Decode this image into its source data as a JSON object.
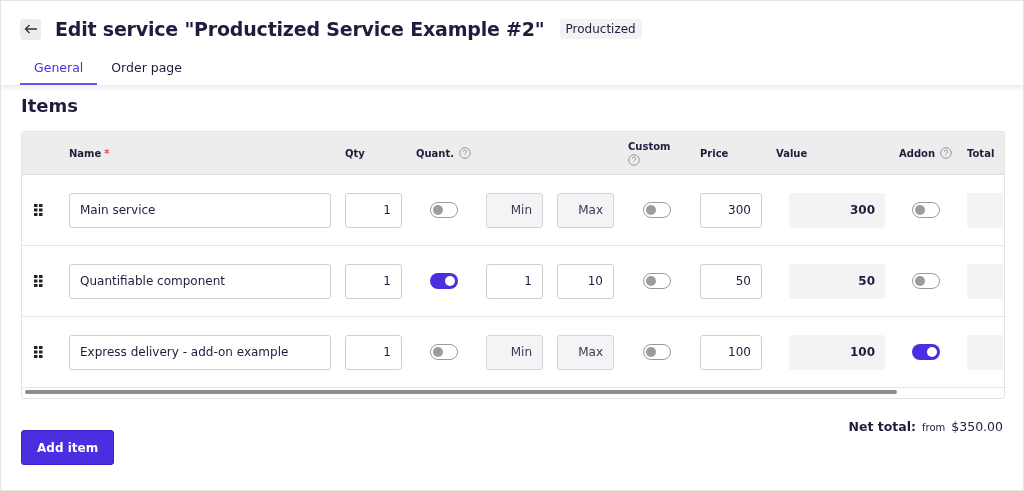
{
  "header": {
    "title": "Edit service \"Productized Service Example #2\"",
    "badge": "Productized"
  },
  "tabs": [
    {
      "label": "General",
      "selected": true
    },
    {
      "label": "Order page",
      "selected": false
    }
  ],
  "section_title": "Items",
  "table": {
    "columns": [
      {
        "label": "Name",
        "required_mark": "*",
        "help": false
      },
      {
        "label": "Qty",
        "help": false
      },
      {
        "label": "Quant.",
        "help": true
      },
      {
        "label": "Custom",
        "help": true
      },
      {
        "label": "Price",
        "help": false
      },
      {
        "label": "Value",
        "help": false
      },
      {
        "label": "Addon",
        "help": true
      },
      {
        "label": "Total",
        "help": false
      }
    ],
    "rows": [
      {
        "name": "Main service",
        "qty": "1",
        "quantifiable": false,
        "min": {
          "placeholder": "Min"
        },
        "max": {
          "placeholder": "Max"
        },
        "custom": false,
        "price": "300",
        "value": "300",
        "addon": false
      },
      {
        "name": "Quantifiable component",
        "qty": "1",
        "quantifiable": true,
        "min": {
          "value": "1"
        },
        "max": {
          "value": "10"
        },
        "custom": false,
        "price": "50",
        "value": "50",
        "addon": false
      },
      {
        "name": "Express delivery - add-on example",
        "qty": "1",
        "quantifiable": false,
        "min": {
          "placeholder": "Min"
        },
        "max": {
          "placeholder": "Max"
        },
        "custom": false,
        "price": "100",
        "value": "100",
        "addon": true
      }
    ]
  },
  "add_button": "Add item",
  "net_total": {
    "label": "Net total:",
    "prefix": "from",
    "amount": "$350.00"
  }
}
